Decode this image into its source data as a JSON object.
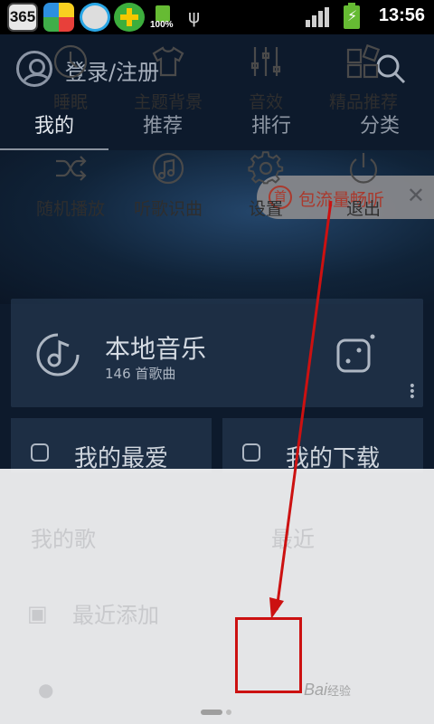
{
  "status_bar": {
    "app_365": "365",
    "battery_label": "100%",
    "time": "13:56"
  },
  "header": {
    "login_label": "登录/注册"
  },
  "tabs": [
    {
      "label": "我的"
    },
    {
      "label": "推荐"
    },
    {
      "label": "排行"
    },
    {
      "label": "分类"
    }
  ],
  "promo": {
    "icon_text": "首",
    "label": "包流量畅听",
    "close": "✕"
  },
  "local_music": {
    "title": "本地音乐",
    "subtitle": "146 首歌曲"
  },
  "cards": {
    "favorites": "我的最爱",
    "downloads": "我的下载"
  },
  "background_ghost": {
    "row1_left": "我的歌",
    "row1_right": "最近",
    "row2_left": "最近添加"
  },
  "menu": {
    "sleep": "睡眠",
    "theme": "主题背景",
    "equalizer": "音效",
    "recommend": "精品推荐",
    "shuffle": "随机播放",
    "recognize": "听歌识曲",
    "settings": "设置",
    "exit": "退出"
  },
  "watermark": {
    "brand": "Bai",
    "suffix": "经验"
  },
  "colors": {
    "accent_red": "#cc1111",
    "promo_text": "#b73a2a"
  }
}
